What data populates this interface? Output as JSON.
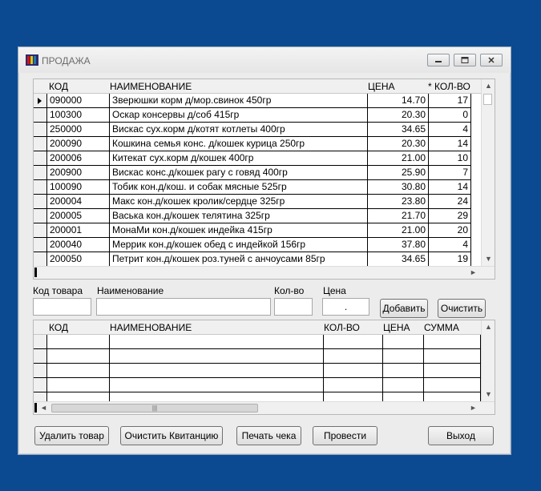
{
  "window": {
    "title": "ПРОДАЖА"
  },
  "products_grid": {
    "columns": [
      "КОД",
      "НАИМЕНОВАНИЕ",
      "ЦЕНА",
      "* КОЛ-ВО"
    ],
    "rows": [
      {
        "code": "090000",
        "name": "Зверюшки корм д/мор.свинок 450гр",
        "price": "14.70",
        "qty": "17"
      },
      {
        "code": "100300",
        "name": "Оскар консервы д/соб 415гр",
        "price": "20.30",
        "qty": "0"
      },
      {
        "code": "250000",
        "name": "Вискас сух.корм д/котят котлеты 400гр",
        "price": "34.65",
        "qty": "4"
      },
      {
        "code": "200090",
        "name": "Кошкина семья конс. д/кошек курица 250гр",
        "price": "20.30",
        "qty": "14"
      },
      {
        "code": "200006",
        "name": "Китекат сух.корм д/кошек 400гр",
        "price": "21.00",
        "qty": "10"
      },
      {
        "code": "200900",
        "name": "Вискас конс.д/кошек рагу с говяд 400гр",
        "price": "25.90",
        "qty": "7"
      },
      {
        "code": "100090",
        "name": "Тобик кон.д/кош. и собак мясные 525гр",
        "price": "30.80",
        "qty": "14"
      },
      {
        "code": "200004",
        "name": "Макс кон.д/кошек кролик/сердце 325гр",
        "price": "23.80",
        "qty": "24"
      },
      {
        "code": "200005",
        "name": "Васька кон.д/кошек телятина 325гр",
        "price": "21.70",
        "qty": "29"
      },
      {
        "code": "200001",
        "name": "МонаМи кон.д/кошек индейка 415гр",
        "price": "21.00",
        "qty": "20"
      },
      {
        "code": "200040",
        "name": "Меррик кон.д/кошек обед с индейкой 156гр",
        "price": "37.80",
        "qty": "4"
      },
      {
        "code": "200050",
        "name": "Петрит кон.д/кошек роз.туней с анчоусами 85гр",
        "price": "34.65",
        "qty": "19"
      }
    ]
  },
  "form": {
    "code_label": "Код товара",
    "name_label": "Наименование",
    "qty_label": "Кол-во",
    "price_label": "Цена",
    "code_value": "",
    "name_value": "",
    "qty_value": "",
    "price_value": ".",
    "add_button": "Добавить",
    "clear_button": "Очистить"
  },
  "receipt_grid": {
    "columns": [
      "КОД",
      "НАИМЕНОВАНИЕ",
      "КОЛ-ВО",
      "ЦЕНА",
      "СУММА"
    ],
    "empty_rows": 5
  },
  "bottom_buttons": {
    "delete": "Удалить товар",
    "clear_receipt": "Очистить Квитанцию",
    "print": "Печать чека",
    "post": "Провести",
    "exit": "Выход"
  },
  "icons": {
    "minimize": "minimize-icon",
    "maximize": "maximize-icon",
    "close": "close-icon",
    "row_pointer": "row-pointer-icon"
  }
}
